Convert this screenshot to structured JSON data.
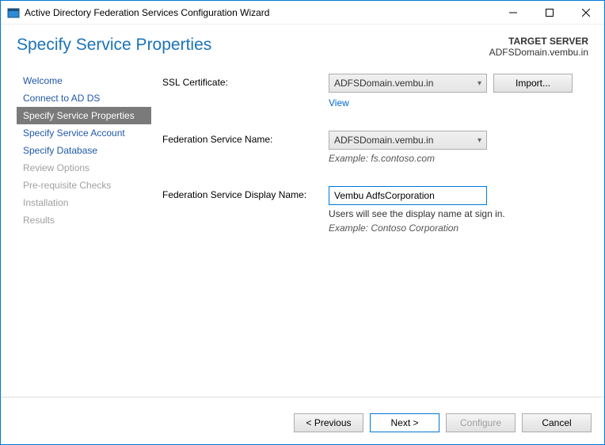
{
  "window": {
    "title": "Active Directory Federation Services Configuration Wizard"
  },
  "page_title": "Specify Service Properties",
  "target": {
    "label": "TARGET SERVER",
    "value": "ADFSDomain.vembu.in"
  },
  "sidebar": {
    "items": [
      {
        "label": "Welcome",
        "state": "enabled"
      },
      {
        "label": "Connect to AD DS",
        "state": "enabled"
      },
      {
        "label": "Specify Service Properties",
        "state": "active"
      },
      {
        "label": "Specify Service Account",
        "state": "enabled"
      },
      {
        "label": "Specify Database",
        "state": "enabled"
      },
      {
        "label": "Review Options",
        "state": "disabled"
      },
      {
        "label": "Pre-requisite Checks",
        "state": "disabled"
      },
      {
        "label": "Installation",
        "state": "disabled"
      },
      {
        "label": "Results",
        "state": "disabled"
      }
    ]
  },
  "form": {
    "ssl_label": "SSL Certificate:",
    "ssl_value": "ADFSDomain.vembu.in",
    "import_button": "Import...",
    "view_link": "View",
    "fed_name_label": "Federation Service Name:",
    "fed_name_value": "ADFSDomain.vembu.in",
    "fed_name_example": "Example: fs.contoso.com",
    "display_name_label": "Federation Service Display Name:",
    "display_name_value": "Vembu AdfsCorporation",
    "display_name_info": "Users will see the display name at sign in.",
    "display_name_example": "Example: Contoso Corporation"
  },
  "footer": {
    "previous": "< Previous",
    "next": "Next >",
    "configure": "Configure",
    "cancel": "Cancel"
  }
}
